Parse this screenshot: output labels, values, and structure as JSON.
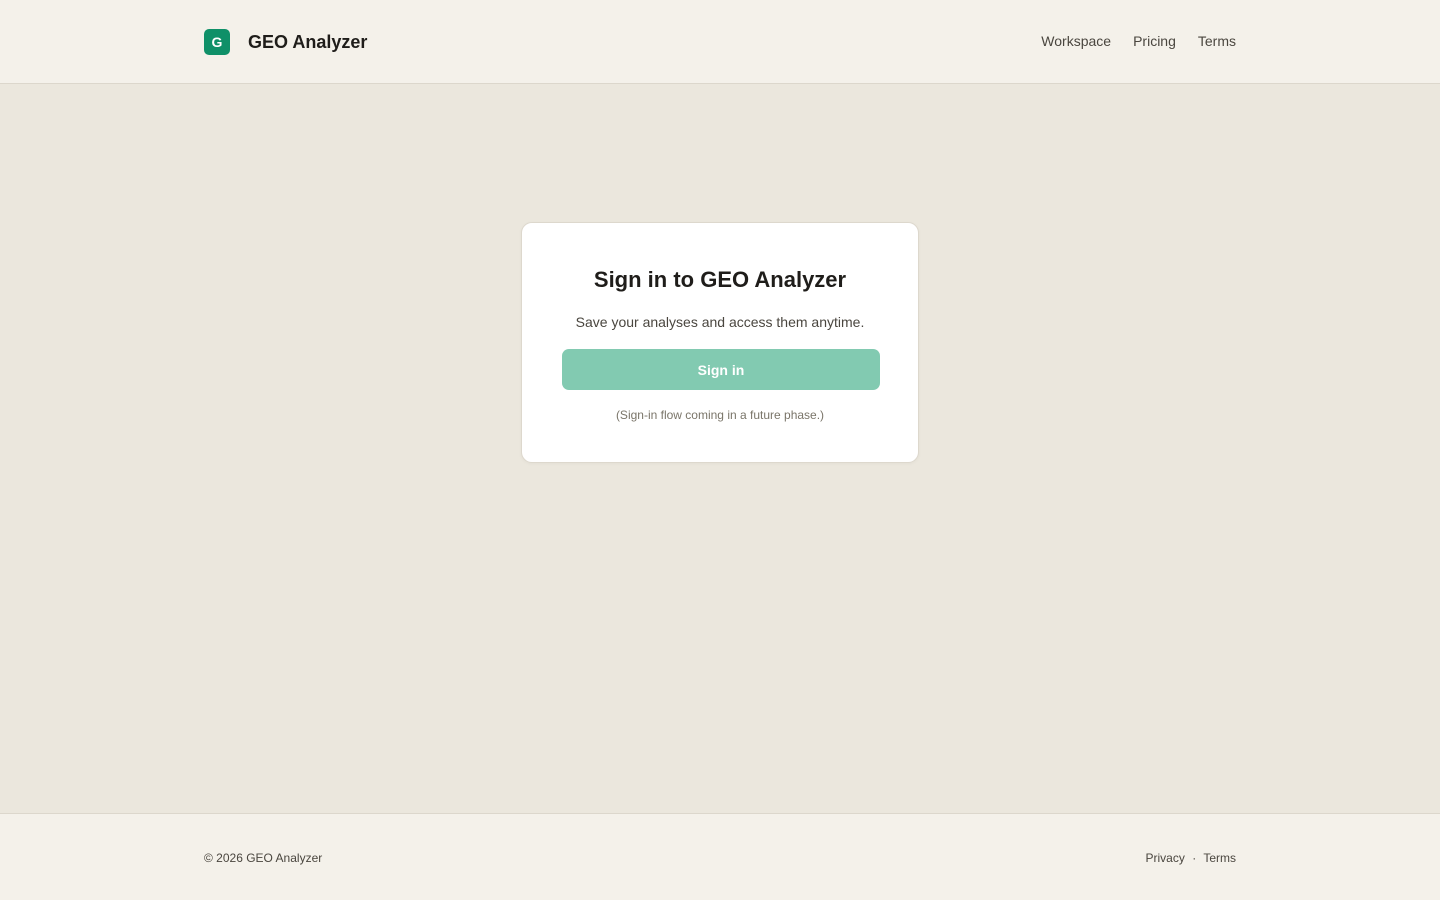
{
  "header": {
    "logo_letter": "G",
    "brand_name": "GEO Analyzer",
    "nav": [
      {
        "label": "Workspace"
      },
      {
        "label": "Pricing"
      },
      {
        "label": "Terms"
      }
    ]
  },
  "card": {
    "title": "Sign in to GEO Analyzer",
    "subtitle": "Save your analyses and access them anytime.",
    "button_label": "Sign in",
    "note": "(Sign-in flow coming in a future phase.)"
  },
  "footer": {
    "copyright": "© 2026 GEO Analyzer",
    "privacy_label": "Privacy",
    "separator": "·",
    "terms_label": "Terms"
  },
  "colors": {
    "accent": "#0f9068",
    "button_disabled": "#82cab1",
    "page_bg": "#ebe7dd",
    "header_bg": "#f4f1ea"
  }
}
